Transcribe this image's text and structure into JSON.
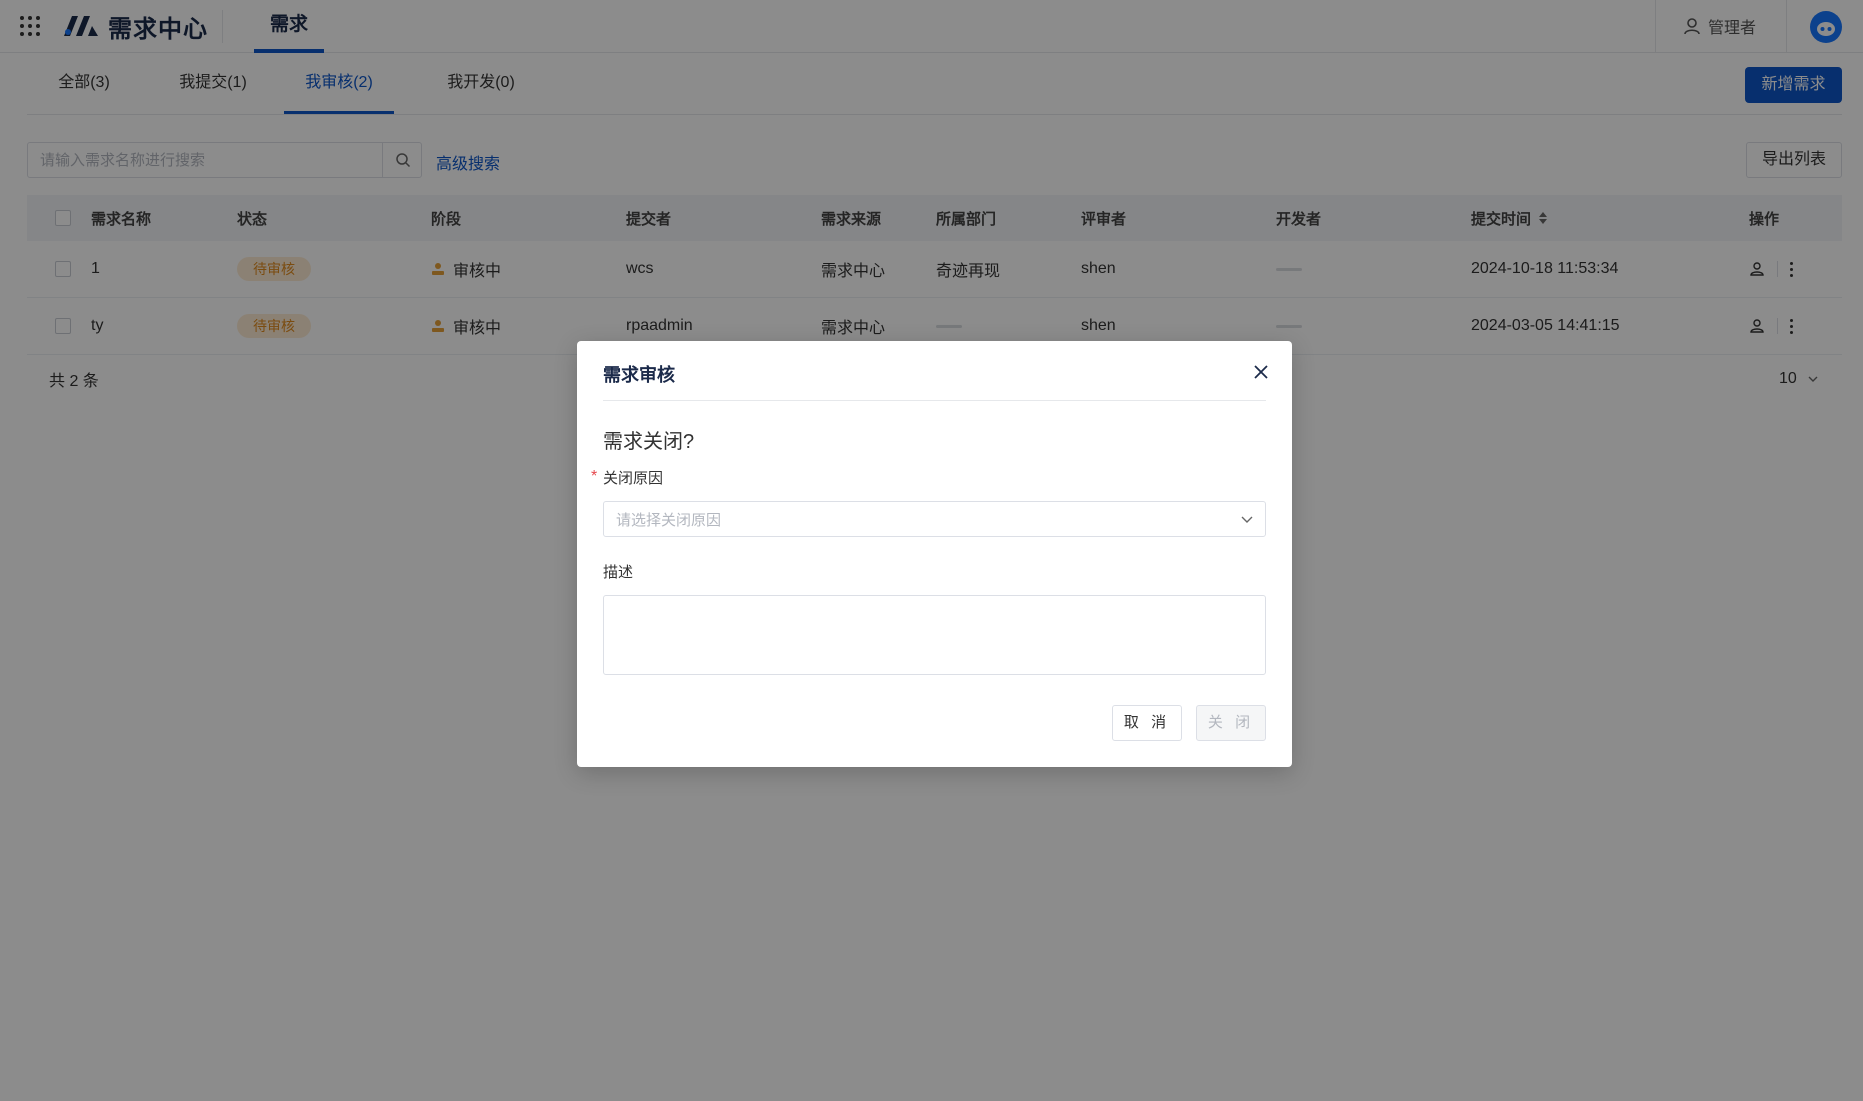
{
  "header": {
    "app_name": "需求中心",
    "nav_tab": "需求",
    "user_name": "管理者",
    "accent_color": "#0d56c9"
  },
  "subtabs": [
    {
      "label": "全部(3)",
      "active": false
    },
    {
      "label": "我提交(1)",
      "active": false
    },
    {
      "label": "我审核(2)",
      "active": true
    },
    {
      "label": "我开发(0)",
      "active": false
    }
  ],
  "toolbar": {
    "new_button": "新增需求",
    "search_placeholder": "请输入需求名称进行搜索",
    "advanced_search": "高级搜索",
    "export_button": "导出列表"
  },
  "table": {
    "columns": [
      "需求名称",
      "状态",
      "阶段",
      "提交者",
      "需求来源",
      "所属部门",
      "评审者",
      "开发者",
      "提交时间",
      "操作"
    ],
    "rows": [
      {
        "name": "1",
        "status": "待审核",
        "stage": "审核中",
        "submitter": "wcs",
        "source": "需求中心",
        "department": "奇迹再现",
        "reviewer": "shen",
        "developer": "",
        "time": "2024-10-18 11:53:34"
      },
      {
        "name": "ty",
        "status": "待审核",
        "stage": "审核中",
        "submitter": "rpaadmin",
        "source": "需求中心",
        "department": "",
        "reviewer": "shen",
        "developer": "",
        "time": "2024-03-05 14:41:15"
      }
    ],
    "total_text": "共 2 条",
    "page_size": "10"
  },
  "dialog": {
    "title": "需求审核",
    "question": "需求关闭?",
    "reason_label": "关闭原因",
    "reason_placeholder": "请选择关闭原因",
    "desc_label": "描述",
    "desc_value": "",
    "cancel_button": "取 消",
    "close_button": "关 闭"
  }
}
